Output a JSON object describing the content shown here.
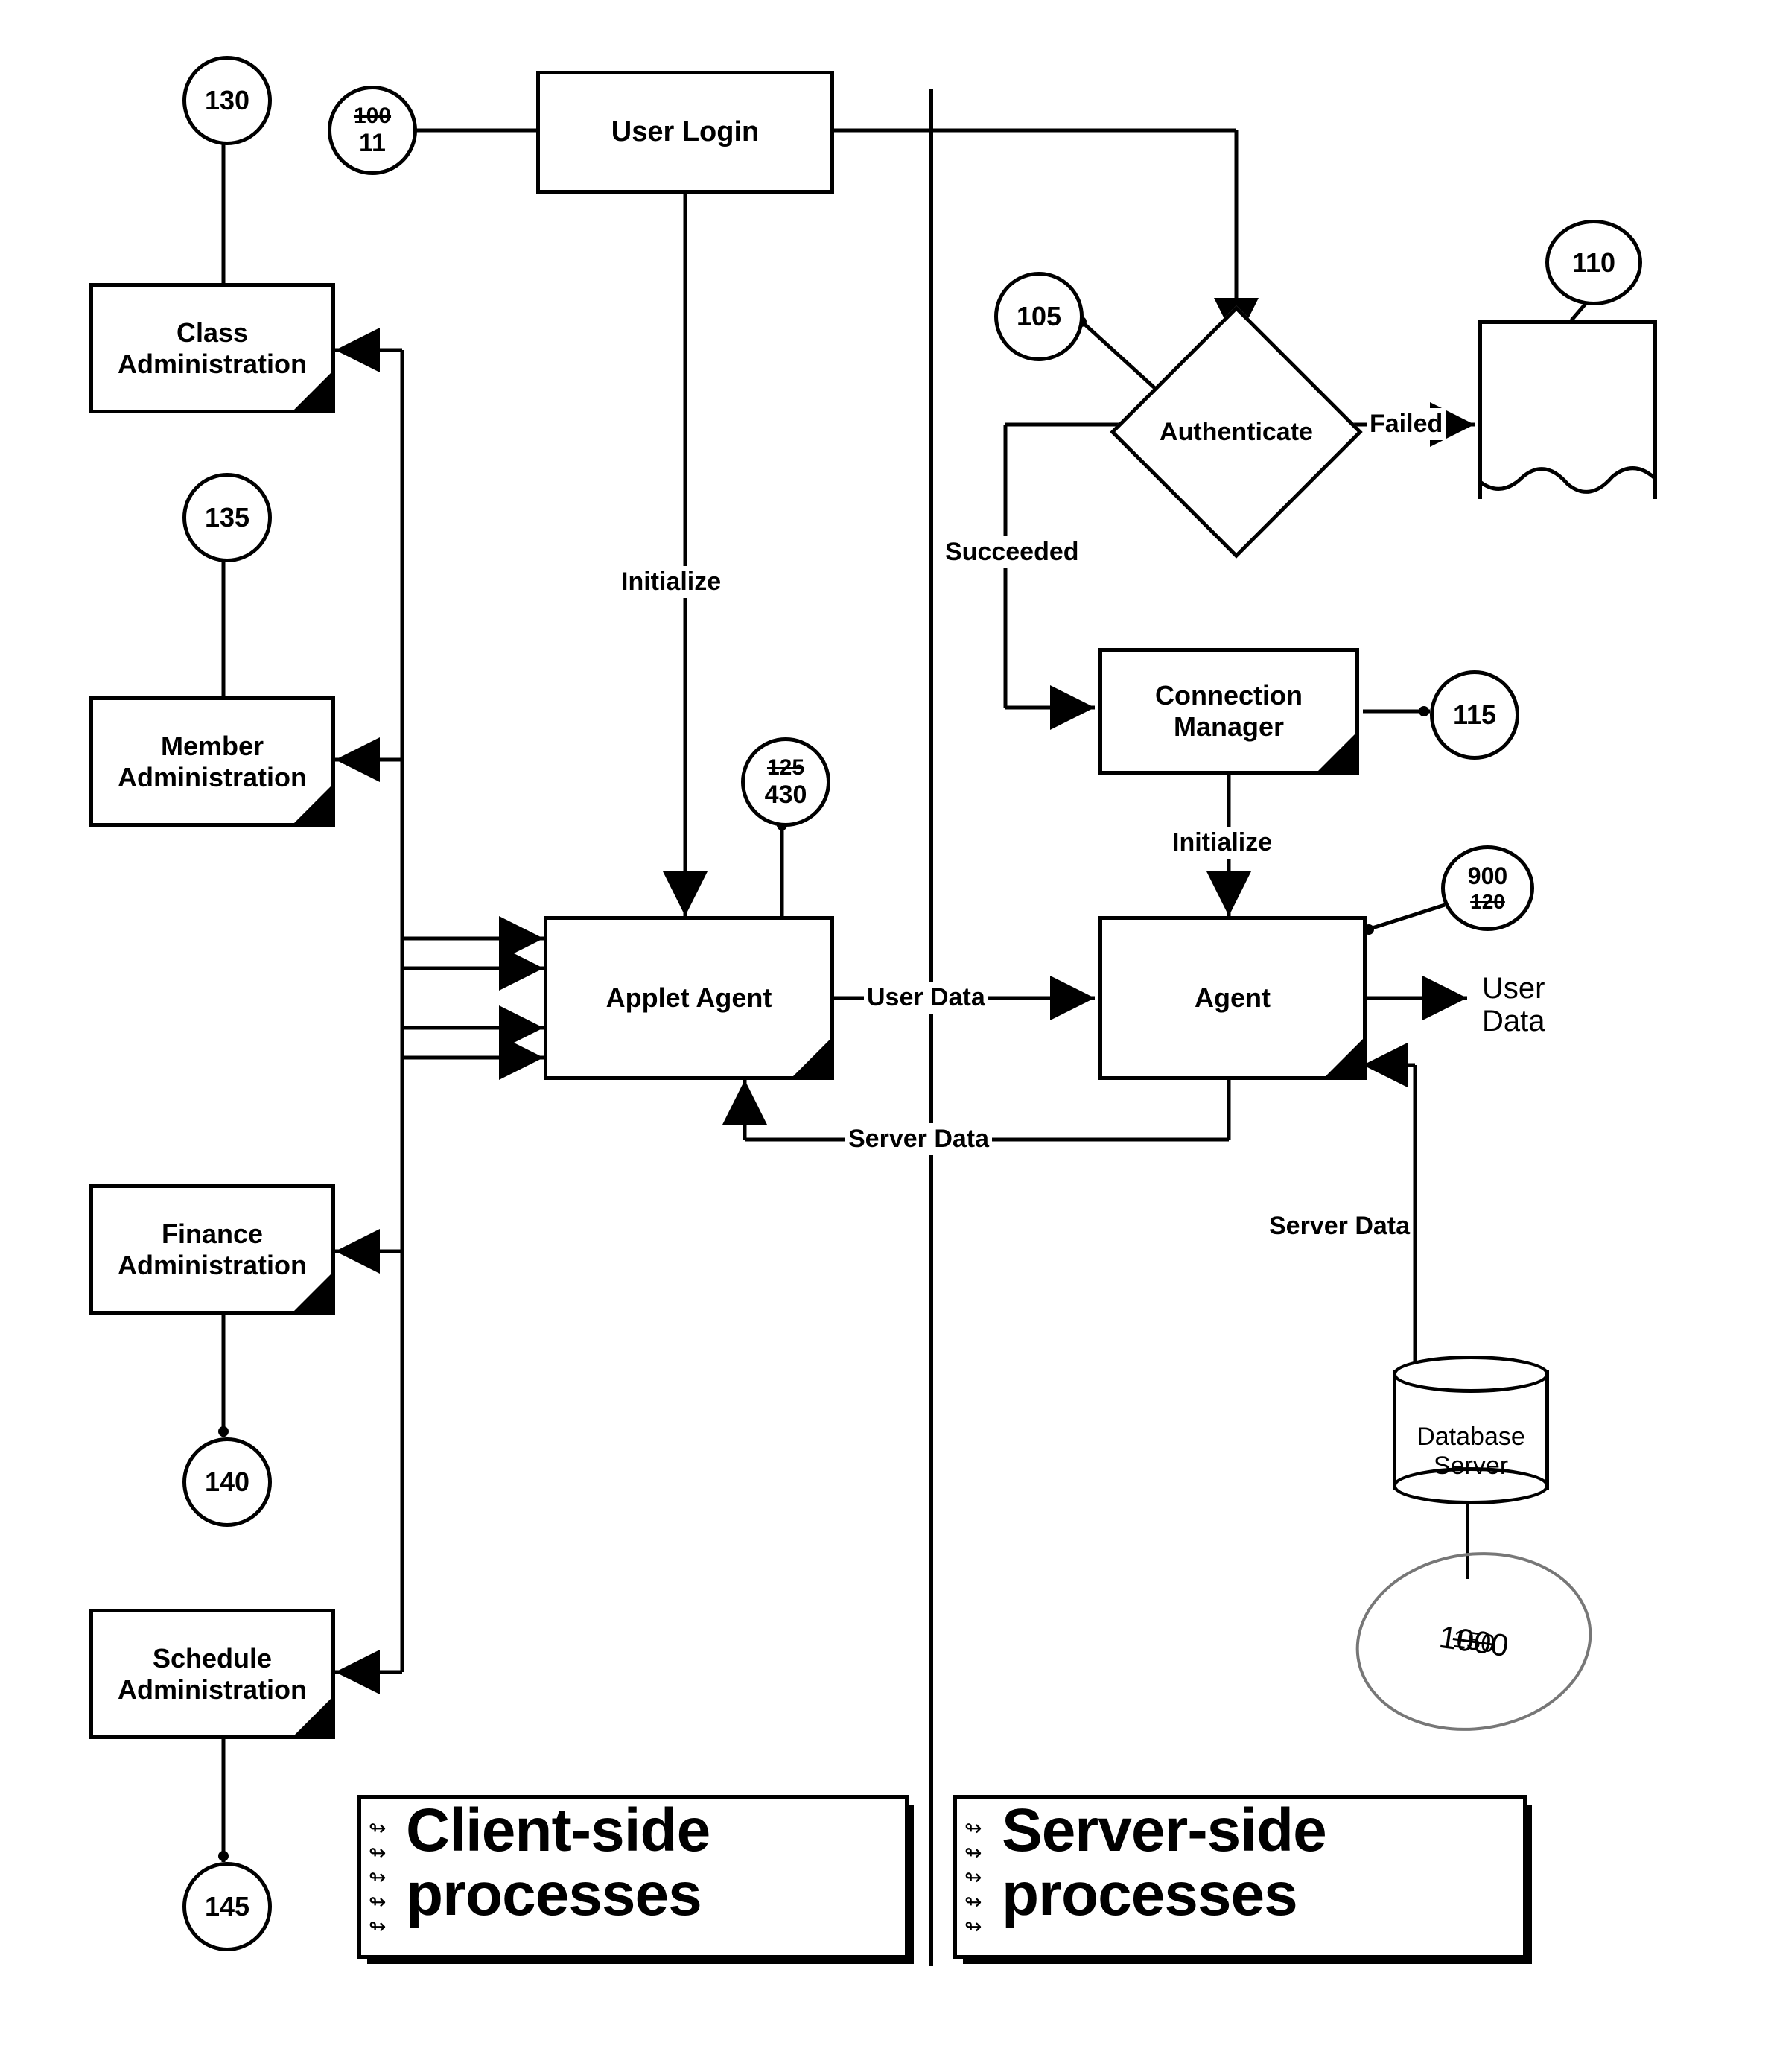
{
  "nodes": {
    "user_login": "User Login",
    "authenticate": "Authenticate",
    "connection_manager": "Connection Manager",
    "applet_agent": "Applet Agent",
    "agent": "Agent",
    "class_admin": "Class Administration",
    "member_admin": "Member Administration",
    "finance_admin": "Finance Administration",
    "schedule_admin": "Schedule Administration",
    "database_server": "Database Server"
  },
  "refs": {
    "r130": "130",
    "r135": "135",
    "r140": "140",
    "r145": "145",
    "r105": "105",
    "r115": "115",
    "r110": "110",
    "r100_strike": "100",
    "r100_hand": "11",
    "r125_strike": "125",
    "r125_hand": "430",
    "r900_hand": "900",
    "r120_strike": "120",
    "r1000_strike": "150",
    "r1000_hand": "1000"
  },
  "edges": {
    "initialize1": "Initialize",
    "initialize2": "Initialize",
    "succeeded": "Succeeded",
    "failed": "Failed",
    "user_data": "User Data",
    "server_data1": "Server Data",
    "server_data2": "Server Data",
    "user_data_hand": "User\nData"
  },
  "captions": {
    "client": "Client-side processes",
    "server": "Server-side processes"
  }
}
